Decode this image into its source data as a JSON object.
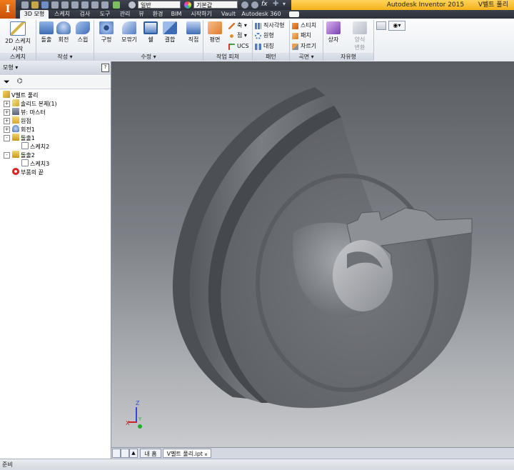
{
  "app": {
    "logo_letter": "I",
    "title_product": "Autodesk Inventor 2015",
    "title_document": "V벨트 풀리",
    "quick_access": {
      "combo_material": "일반",
      "combo_appearance": "기본값",
      "fx_label": "fx"
    }
  },
  "tabs": [
    "3D 모형",
    "스케치",
    "검사",
    "도구",
    "관리",
    "뷰",
    "환경",
    "BIM",
    "시작하기",
    "Vault",
    "Autodesk 360"
  ],
  "active_tab": "3D 모형",
  "ribbon": {
    "sketch": {
      "panel": "스케치",
      "start_2d_sketch_line1": "2D 스케치",
      "start_2d_sketch_line2": "시작"
    },
    "create": {
      "panel": "작성",
      "extrude": "돌출",
      "revolve": "회전",
      "sweep": "스윕"
    },
    "modify": {
      "panel": "수정",
      "hole": "구멍",
      "fillet": "모깎기",
      "shell": "쉘",
      "combine": "결합"
    },
    "work_features": {
      "panel": "작업 피쳐",
      "direct": "직접",
      "plane": "평면",
      "axis": "축",
      "point": "점",
      "ucs": "UCS"
    },
    "pattern": {
      "panel": "패턴",
      "rectangular": "직사각형",
      "circular": "원형",
      "mirror": "대칭"
    },
    "surface": {
      "panel": "곡면",
      "stitch": "스티치",
      "patch": "패치",
      "trim": "자르기"
    },
    "freeform": {
      "panel": "자유형",
      "box": "상자",
      "convert_line1": "양식",
      "convert_line2": "변환"
    }
  },
  "browser": {
    "header": "모형",
    "help_label": "?",
    "tree": [
      {
        "label": "V벨트 풀리",
        "icon": "part-icon",
        "level": 0
      },
      {
        "label": "솔리드 본체(1)",
        "icon": "solid-bodies-icon",
        "level": 1,
        "expander": "+"
      },
      {
        "label": "뷰: 마스터",
        "icon": "view-icon",
        "level": 1,
        "expander": "+"
      },
      {
        "label": "원점",
        "icon": "origin-folder-icon",
        "level": 1,
        "expander": "+"
      },
      {
        "label": "회전1",
        "icon": "revolve-feature-icon",
        "level": 1,
        "expander": "+"
      },
      {
        "label": "돌출1",
        "icon": "extrude-feature-icon",
        "level": 1,
        "expander": "-"
      },
      {
        "label": "스케치2",
        "icon": "sketch-icon",
        "level": 2
      },
      {
        "label": "돌출2",
        "icon": "extrude-feature-icon",
        "level": 1,
        "expander": "-"
      },
      {
        "label": "스케치3",
        "icon": "sketch-icon",
        "level": 2
      },
      {
        "label": "부품의 끝",
        "icon": "end-of-part-icon",
        "level": 1
      }
    ]
  },
  "viewport": {
    "triad": {
      "x": "X",
      "y": "Y",
      "z": "Z"
    }
  },
  "document_tabs": {
    "home": "내 홈",
    "active_doc": "V벨트 풀리.ipt",
    "close_glyph": "¤"
  },
  "status": {
    "text": "준비"
  },
  "colors": {
    "app_orange": "#e8731a",
    "title_gold": "#f6b21b",
    "tab_dark": "#2f343c",
    "model_gray": "#6a6d72"
  }
}
